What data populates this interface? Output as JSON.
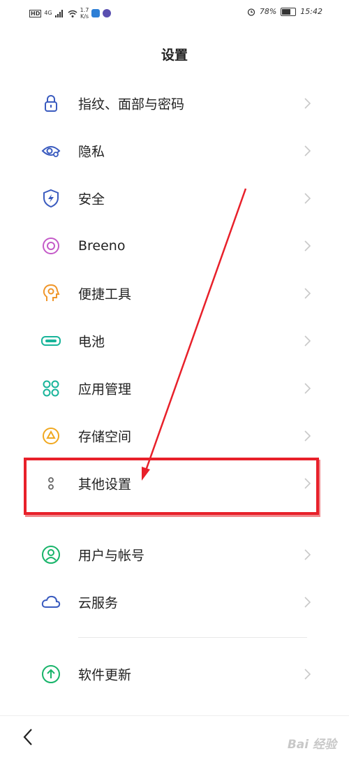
{
  "status_bar": {
    "left_badge": "HD",
    "network": "4G",
    "speed_value": "1.7",
    "speed_unit": "K/s",
    "battery_percent": "78%",
    "battery_level": 0.78,
    "time": "15:42"
  },
  "header": {
    "title": "设置"
  },
  "settings_items": [
    {
      "label": "指纹、面部与密码",
      "icon": "lock-icon",
      "color": "#3a5bbf"
    },
    {
      "label": "隐私",
      "icon": "privacy-eye-icon",
      "color": "#3a5bbf"
    },
    {
      "label": "安全",
      "icon": "shield-icon",
      "color": "#3a5bbf"
    },
    {
      "label": "Breeno",
      "icon": "breeno-icon",
      "color": "#c45ac8"
    },
    {
      "label": "便捷工具",
      "icon": "tools-head-icon",
      "color": "#f0962a"
    },
    {
      "label": "电池",
      "icon": "battery-icon",
      "color": "#18b49a"
    },
    {
      "label": "应用管理",
      "icon": "apps-grid-icon",
      "color": "#18b49a"
    },
    {
      "label": "存储空间",
      "icon": "storage-pie-icon",
      "color": "#f0a820"
    },
    {
      "label": "其他设置",
      "icon": "more-dots-icon",
      "color": "#666666"
    },
    {
      "label": "用户与帐号",
      "icon": "user-icon",
      "color": "#18b46a"
    },
    {
      "label": "云服务",
      "icon": "cloud-icon",
      "color": "#3a5bbf"
    },
    {
      "label": "软件更新",
      "icon": "update-arrow-icon",
      "color": "#18b46a"
    }
  ],
  "annotation": {
    "color": "#e8202a"
  },
  "nav": {
    "back_icon": "back-chevron-icon"
  },
  "watermark": {
    "text": "Bai 经验"
  }
}
